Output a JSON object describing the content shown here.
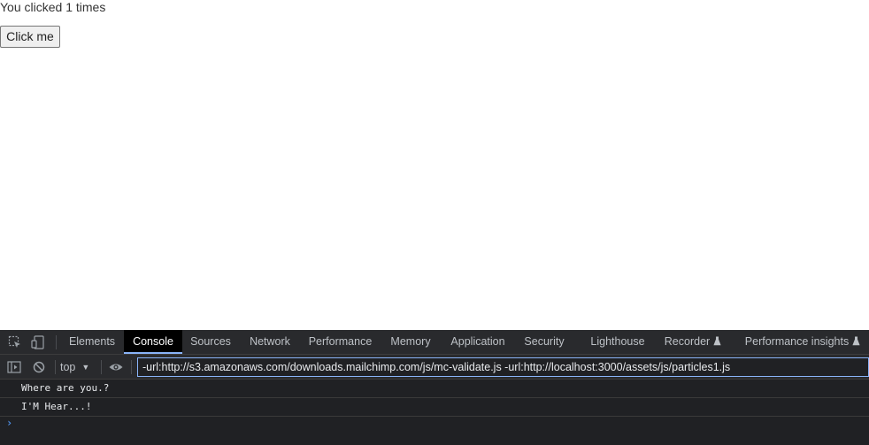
{
  "page": {
    "click_text": "You clicked 1 times",
    "button_label": "Click me"
  },
  "devtools": {
    "tabs": [
      {
        "label": "Elements",
        "active": false
      },
      {
        "label": "Console",
        "active": true
      },
      {
        "label": "Sources",
        "active": false
      },
      {
        "label": "Network",
        "active": false
      },
      {
        "label": "Performance",
        "active": false
      },
      {
        "label": "Memory",
        "active": false
      },
      {
        "label": "Application",
        "active": false
      },
      {
        "label": "Security",
        "active": false
      },
      {
        "label": "Lighthouse",
        "active": false
      },
      {
        "label": "Recorder",
        "active": false,
        "experimental": true
      },
      {
        "label": "Performance insights",
        "active": false,
        "experimental": true
      }
    ],
    "toolbar": {
      "context": "top",
      "filter_value": "-url:http://s3.amazonaws.com/downloads.mailchimp.com/js/mc-validate.js -url:http://localhost:3000/assets/js/particles1.js"
    },
    "messages": [
      "Where are you.?",
      "I'M Hear...!"
    ],
    "prompt_symbol": "›",
    "colors": {
      "panel_bg": "#202124",
      "tab_bg": "#292a2d",
      "active_tab_bg": "#000000",
      "focus_blue": "#8ab4f8"
    }
  }
}
